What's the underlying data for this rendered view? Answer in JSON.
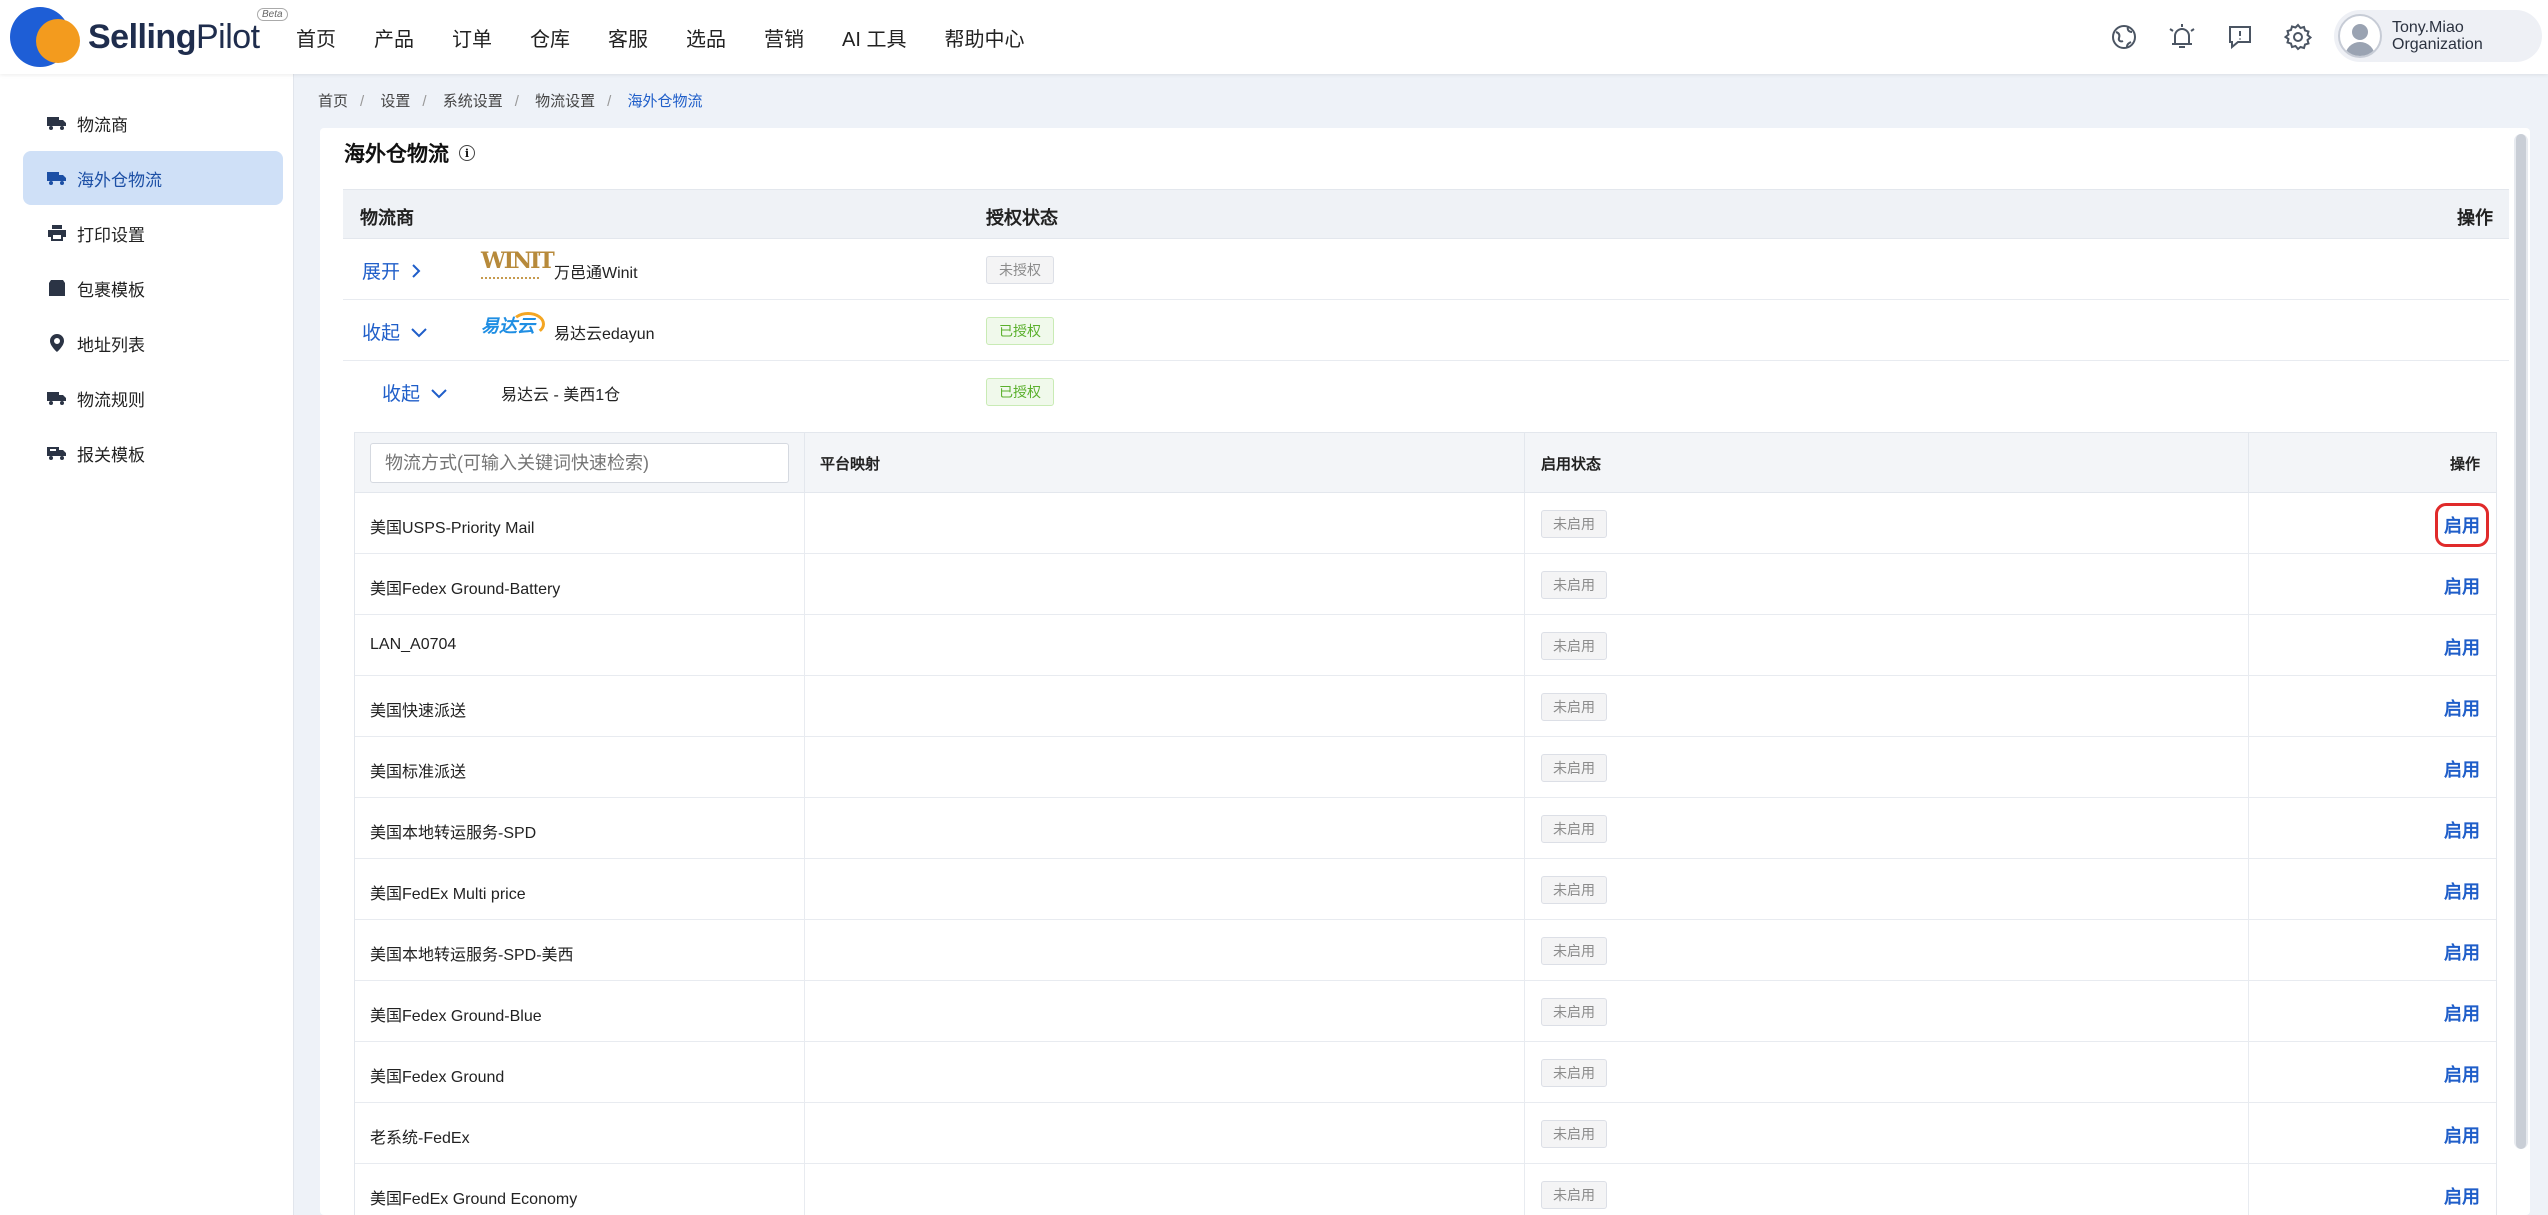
{
  "app": {
    "logo_text_bold": "Selling",
    "logo_text_light": "Pilot",
    "beta": "Beta"
  },
  "nav": [
    "首页",
    "产品",
    "订单",
    "仓库",
    "客服",
    "选品",
    "营销",
    "AI 工具",
    "帮助中心"
  ],
  "header_icons": [
    "globe-icon",
    "bell-icon",
    "message-icon",
    "gear-icon"
  ],
  "user": {
    "name": "Tony.Miao",
    "org": "Organization"
  },
  "sidebar": [
    {
      "label": "物流商",
      "icon": "truck-icon",
      "active": false
    },
    {
      "label": "海外仓物流",
      "icon": "truck-icon",
      "active": true
    },
    {
      "label": "打印设置",
      "icon": "printer-icon",
      "active": false
    },
    {
      "label": "包裹模板",
      "icon": "package-icon",
      "active": false
    },
    {
      "label": "地址列表",
      "icon": "location-pin-icon",
      "active": false
    },
    {
      "label": "物流规则",
      "icon": "truck-rule-icon",
      "active": false
    },
    {
      "label": "报关模板",
      "icon": "customs-icon",
      "active": false
    }
  ],
  "breadcrumb": [
    "首页",
    "设置",
    "系统设置",
    "物流设置",
    "海外仓物流"
  ],
  "page_title": "海外仓物流",
  "providers_table": {
    "headers": {
      "provider": "物流商",
      "auth": "授权状态",
      "ops": "操作"
    },
    "rows": [
      {
        "toggle": "展开",
        "logo_text": "WINIT",
        "name": "万邑通Winit",
        "status": "未授权"
      },
      {
        "toggle": "收起",
        "logo_text": "易达云",
        "name": "易达云edayun",
        "status": "已授权"
      },
      {
        "toggle": "收起",
        "name": "易达云 - 美西1仓",
        "status": "已授权"
      }
    ]
  },
  "methods_table": {
    "search_placeholder": "物流方式(可输入关键词快速检索)",
    "headers": {
      "mapping": "平台映射",
      "enabled": "启用状态",
      "ops": "操作"
    },
    "rows": [
      {
        "name": "美国USPS-Priority Mail",
        "status": "未启用",
        "action": "启用"
      },
      {
        "name": "美国Fedex Ground-Battery",
        "status": "未启用",
        "action": "启用"
      },
      {
        "name": "LAN_A0704",
        "status": "未启用",
        "action": "启用"
      },
      {
        "name": "美国快速派送",
        "status": "未启用",
        "action": "启用"
      },
      {
        "name": "美国标准派送",
        "status": "未启用",
        "action": "启用"
      },
      {
        "name": "美国本地转运服务-SPD",
        "status": "未启用",
        "action": "启用"
      },
      {
        "name": "美国FedEx Multi price",
        "status": "未启用",
        "action": "启用"
      },
      {
        "name": "美国本地转运服务-SPD-美西",
        "status": "未启用",
        "action": "启用"
      },
      {
        "name": "美国Fedex Ground-Blue",
        "status": "未启用",
        "action": "启用"
      },
      {
        "name": "美国Fedex Ground",
        "status": "未启用",
        "action": "启用"
      },
      {
        "name": "老系统-FedEx",
        "status": "未启用",
        "action": "启用"
      },
      {
        "name": "美国FedEx Ground Economy",
        "status": "未启用",
        "action": "启用"
      }
    ]
  },
  "colors": {
    "accent": "#1f5ec9",
    "highlight": "#e02a2a",
    "active_bg": "#cfe0f7",
    "authorized": "#5ab02c"
  }
}
